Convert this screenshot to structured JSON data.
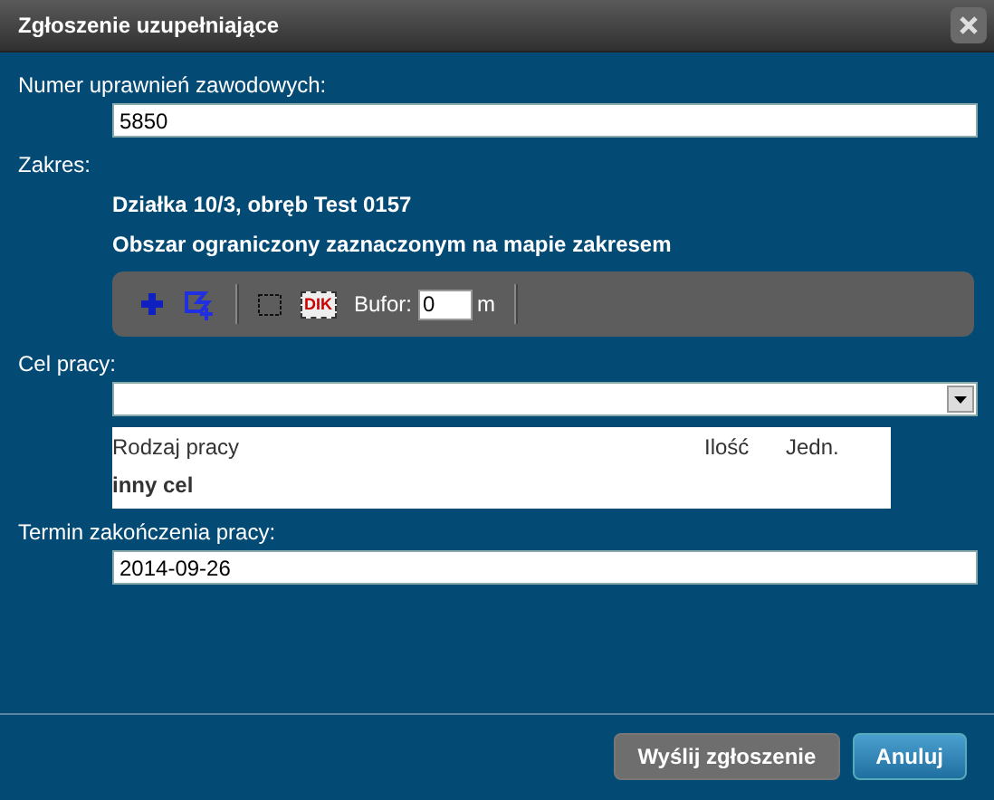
{
  "window": {
    "title": "Zgłoszenie uzupełniające"
  },
  "license": {
    "label": "Numer uprawnień zawodowych:",
    "value": "5850"
  },
  "scope": {
    "label": "Zakres:",
    "lines": [
      "Działka 10/3, obręb Test 0157",
      "Obszar ograniczony zaznaczonym na mapie zakresem"
    ]
  },
  "toolbar": {
    "items": [
      {
        "kind": "add-point"
      },
      {
        "kind": "polygon"
      },
      {
        "kind": "separator"
      },
      {
        "kind": "select-box"
      },
      {
        "kind": "text-select",
        "text": "DIK"
      },
      {
        "kind": "buffer",
        "label": "Bufor:",
        "value": "0",
        "unit": "m"
      },
      {
        "kind": "separator"
      }
    ]
  },
  "purpose": {
    "label": "Cel pracy:",
    "columns": [
      "Rodzaj pracy",
      "Ilość",
      "Jedn."
    ],
    "rows": [
      "inny cel"
    ]
  },
  "end_date": {
    "label": "Termin zakończenia pracy:",
    "value": "2014-09-26"
  },
  "buttons": [
    {
      "label": "Wyślij zgłoszenie",
      "kind": "secondary"
    },
    {
      "label": "Anuluj",
      "kind": "primary"
    }
  ]
}
